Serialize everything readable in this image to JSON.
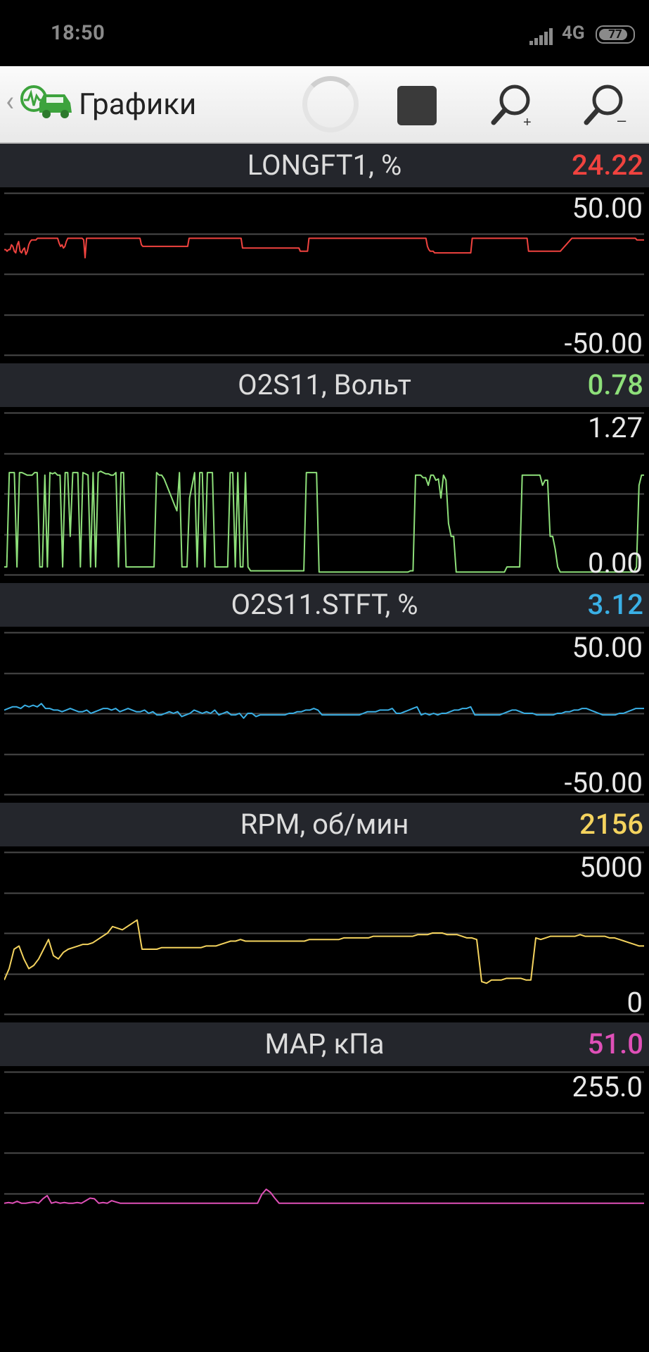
{
  "status_bar": {
    "time": "18:50",
    "network": "4G",
    "battery": "77"
  },
  "toolbar": {
    "title": "Графики",
    "icons": [
      "back-chevron-icon",
      "app-logo-icon",
      "progress-spinner-icon",
      "stop-icon",
      "zoom-in-icon",
      "zoom-out-icon"
    ]
  },
  "charts": [
    {
      "name": "LONGFT1, %",
      "value": "24.22",
      "color": "#f0433f",
      "ymax": "50.00",
      "ymin": "-50.00",
      "range": [
        -50,
        50
      ],
      "series": [
        15,
        15,
        14,
        15,
        15,
        18,
        17,
        14,
        13,
        18,
        20,
        14,
        13,
        15,
        16,
        12,
        14,
        18,
        20,
        21,
        21,
        21,
        21,
        22,
        22,
        22,
        22,
        22,
        22,
        22,
        22,
        22,
        22,
        22,
        22,
        22,
        22,
        22,
        19,
        17,
        18,
        16,
        17,
        20,
        22,
        22,
        22,
        22,
        22,
        22,
        22,
        22,
        22,
        22,
        22,
        21,
        10,
        22,
        22,
        22,
        22,
        22,
        22,
        22,
        22,
        22,
        22,
        22,
        22,
        22,
        22,
        22,
        22,
        22,
        22,
        22,
        22,
        22,
        22,
        22,
        22,
        22,
        22,
        22,
        22,
        22,
        22,
        22,
        22,
        22,
        22,
        22,
        22,
        22,
        22,
        18,
        17,
        17,
        17,
        17,
        17,
        17,
        17,
        17,
        17,
        17,
        17,
        17,
        17,
        17,
        17,
        17,
        17,
        17,
        17,
        17,
        17,
        17,
        17,
        17,
        17,
        17,
        17,
        17,
        17,
        17,
        17,
        17,
        22,
        22,
        22,
        22,
        22,
        22,
        22,
        22,
        22,
        22,
        22,
        22,
        22,
        22,
        22,
        22,
        22,
        22,
        22,
        22,
        22,
        22,
        22,
        22,
        22,
        22,
        22,
        22,
        22,
        22,
        22,
        22,
        22,
        22,
        22,
        22,
        22,
        16,
        16,
        16,
        16,
        16,
        16,
        16,
        16,
        16,
        16,
        16,
        16,
        16,
        16,
        16,
        16,
        16,
        16,
        16,
        16,
        16,
        16,
        16,
        16,
        16,
        16,
        16,
        16,
        16,
        16,
        16,
        16,
        16,
        16,
        16,
        16,
        16,
        16,
        16,
        16,
        14,
        14,
        14,
        14,
        14,
        14,
        22,
        22,
        22,
        22,
        22,
        22,
        22,
        22,
        22,
        22,
        22,
        22,
        22,
        22,
        22,
        22,
        22,
        22,
        22,
        22,
        22,
        22,
        22,
        22,
        22,
        22,
        22,
        22,
        22,
        22,
        22,
        22,
        22,
        22,
        22,
        22,
        22,
        22,
        22,
        22,
        22,
        22,
        22,
        22,
        22,
        22,
        22,
        22,
        22,
        22,
        22,
        22,
        22,
        22,
        22,
        22,
        22,
        22,
        22,
        22,
        22,
        22,
        22,
        22,
        22,
        22,
        22,
        22,
        22,
        22,
        22,
        22,
        22,
        22,
        22,
        22,
        22,
        22,
        22,
        22,
        22,
        22,
        17,
        15,
        14,
        14,
        14,
        13,
        13,
        13,
        13,
        13,
        13,
        13,
        13,
        13,
        13,
        13,
        13,
        13,
        13,
        13,
        13,
        13,
        13,
        13,
        13,
        13,
        13,
        13,
        13,
        13,
        13,
        22,
        22,
        22,
        22,
        22,
        22,
        22,
        22,
        22,
        22,
        22,
        22,
        22,
        22,
        22,
        22,
        22,
        22,
        22,
        22,
        22,
        22,
        22,
        22,
        22,
        22,
        22,
        22,
        22,
        22,
        22,
        22,
        22,
        22,
        22,
        22,
        22,
        22,
        22,
        14,
        14,
        14,
        14,
        14,
        14,
        14,
        14,
        14,
        14,
        14,
        14,
        14,
        14,
        14,
        14,
        14,
        14,
        14,
        14,
        14,
        14,
        14,
        15,
        16,
        17,
        18,
        19,
        20,
        21,
        22,
        22,
        22,
        22,
        22,
        22,
        22,
        22,
        22,
        22,
        22,
        22,
        22,
        22,
        22,
        22,
        22,
        22,
        22,
        22,
        22,
        22,
        22,
        22,
        22,
        22,
        22,
        22,
        22,
        22,
        22,
        22,
        22,
        22,
        22,
        22,
        22,
        22,
        22,
        22,
        22,
        22,
        22,
        22,
        22,
        21,
        21,
        21,
        21,
        21,
        21
      ]
    },
    {
      "name": "O2S11, Вольт",
      "value": "0.78",
      "color": "#8ee07a",
      "ymax": "1.27",
      "ymin": "0.00",
      "range": [
        0,
        1.27
      ],
      "series": [
        0.06,
        0.06,
        0.8,
        0.8,
        0.8,
        0.06,
        0.8,
        0.8,
        0.79,
        0.78,
        0.78,
        0.78,
        0.8,
        0.8,
        0.06,
        0.06,
        0.78,
        0.06,
        0.8,
        0.79,
        0.8,
        0.78,
        0.78,
        0.06,
        0.8,
        0.8,
        0.3,
        0.8,
        0.8,
        0.8,
        0.06,
        0.8,
        0.79,
        0.78,
        0.06,
        0.8,
        0.06,
        0.8,
        0.81,
        0.8,
        0.79,
        0.79,
        0.78,
        0.78,
        0.8,
        0.06,
        0.8,
        0.8,
        0.06,
        0.06,
        0.06,
        0.06,
        0.06,
        0.06,
        0.06,
        0.06,
        0.06,
        0.06,
        0.06,
        0.06,
        0.8,
        0.78,
        0.78,
        0.75,
        0.7,
        0.65,
        0.6,
        0.55,
        0.5,
        0.8,
        0.06,
        0.06,
        0.06,
        0.6,
        0.7,
        0.8,
        0.06,
        0.8,
        0.8,
        0.06,
        0.8,
        0.8,
        0.8,
        0.06,
        0.06,
        0.06,
        0.06,
        0.06,
        0.06,
        0.8,
        0.8,
        0.06,
        0.8,
        0.06,
        0.06,
        0.8,
        0.06,
        0.03,
        0.03,
        0.03,
        0.03,
        0.03,
        0.03,
        0.03,
        0.03,
        0.03,
        0.03,
        0.03,
        0.03,
        0.03,
        0.03,
        0.03,
        0.03,
        0.03,
        0.03,
        0.03,
        0.03,
        0.03,
        0.03,
        0.8,
        0.8,
        0.8,
        0.8,
        0.8,
        0.02,
        0.02,
        0.02,
        0.02,
        0.02,
        0.02,
        0.02,
        0.02,
        0.02,
        0.02,
        0.02,
        0.02,
        0.02,
        0.02,
        0.02,
        0.02,
        0.02,
        0.02,
        0.02,
        0.02,
        0.02,
        0.02,
        0.02,
        0.02,
        0.02,
        0.02,
        0.02,
        0.02,
        0.02,
        0.02,
        0.02,
        0.02,
        0.02,
        0.02,
        0.02,
        0.02,
        0.03,
        0.03,
        0.78,
        0.78,
        0.78,
        0.76,
        0.76,
        0.7,
        0.78,
        0.78,
        0.74,
        0.75,
        0.6,
        0.78,
        0.74,
        0.4,
        0.3,
        0.3,
        0.02,
        0.02,
        0.02,
        0.02,
        0.02,
        0.02,
        0.02,
        0.02,
        0.02,
        0.02,
        0.02,
        0.02,
        0.02,
        0.02,
        0.02,
        0.02,
        0.02,
        0.02,
        0.02,
        0.02,
        0.06,
        0.06,
        0.06,
        0.06,
        0.06,
        0.06,
        0.78,
        0.78,
        0.78,
        0.78,
        0.78,
        0.78,
        0.78,
        0.78,
        0.7,
        0.74,
        0.74,
        0.3,
        0.3,
        0.2,
        0.06,
        0.02,
        0.02,
        0.02,
        0.02,
        0.02,
        0.02,
        0.02,
        0.02,
        0.02,
        0.02,
        0.02,
        0.02,
        0.02,
        0.02,
        0.02,
        0.02,
        0.02,
        0.02,
        0.02,
        0.02,
        0.02,
        0.02,
        0.02,
        0.02,
        0.02,
        0.02,
        0.02,
        0.02,
        0.02,
        0.02,
        0.06,
        0.7,
        0.78,
        0.78
      ]
    },
    {
      "name": "O2S11.STFT, %",
      "value": "3.12",
      "color": "#3ab0e6",
      "ymax": "50.00",
      "ymin": "-50.00",
      "range": [
        -50,
        50
      ],
      "series": [
        2,
        3,
        4,
        4,
        3,
        5,
        4,
        5,
        4,
        6,
        3,
        3,
        2,
        2,
        1,
        2,
        3,
        2,
        1,
        1,
        2,
        0,
        1,
        2,
        3,
        3,
        2,
        3,
        1,
        2,
        3,
        2,
        1,
        1,
        2,
        0,
        1,
        -1,
        -1,
        0,
        1,
        0,
        1,
        -2,
        -1,
        0,
        2,
        1,
        0,
        1,
        0,
        2,
        -1,
        0,
        1,
        -1,
        -1,
        0,
        -3,
        0,
        0,
        -2,
        -1,
        -1,
        -1,
        -1,
        -1,
        -1,
        -1,
        0,
        0,
        1,
        1,
        2,
        2,
        3,
        2,
        -1,
        -1,
        -1,
        -1,
        -1,
        -1,
        -1,
        -1,
        -1,
        -1,
        0,
        1,
        1,
        1,
        2,
        2,
        2,
        3,
        0,
        0,
        1,
        2,
        3,
        4,
        -1,
        0,
        -1,
        0,
        -1,
        0,
        0,
        1,
        2,
        2,
        3,
        3,
        4,
        -1,
        -1,
        -1,
        -1,
        -1,
        -1,
        -1,
        0,
        1,
        2,
        2,
        1,
        0,
        0,
        0,
        -1,
        -1,
        -1,
        -1,
        -1,
        0,
        0,
        1,
        1,
        2,
        2,
        3,
        3,
        2,
        1,
        0,
        -1,
        -1,
        -1,
        -1,
        0,
        0,
        1,
        2,
        3,
        3,
        3
      ]
    },
    {
      "name": "RPM, об/мин",
      "value": "2156",
      "color": "#f4d35e",
      "ymax": "5000",
      "ymin": "0",
      "range": [
        0,
        5000
      ],
      "series": [
        1050,
        1400,
        2000,
        2100,
        1700,
        1400,
        1500,
        1700,
        2000,
        2300,
        1800,
        1700,
        1900,
        2000,
        2050,
        2100,
        2150,
        2150,
        2200,
        2300,
        2400,
        2500,
        2700,
        2650,
        2600,
        2700,
        2800,
        2900,
        2000,
        2000,
        2000,
        2000,
        2050,
        2050,
        2050,
        2050,
        2050,
        2050,
        2050,
        2050,
        2050,
        2100,
        2100,
        2100,
        2150,
        2200,
        2250,
        2250,
        2300,
        2250,
        2250,
        2250,
        2250,
        2250,
        2250,
        2250,
        2250,
        2250,
        2250,
        2250,
        2250,
        2250,
        2300,
        2300,
        2300,
        2300,
        2300,
        2300,
        2300,
        2350,
        2350,
        2350,
        2350,
        2350,
        2350,
        2400,
        2400,
        2400,
        2400,
        2400,
        2400,
        2400,
        2400,
        2400,
        2450,
        2450,
        2450,
        2500,
        2500,
        2500,
        2450,
        2450,
        2450,
        2400,
        2350,
        2350,
        2300,
        1000,
        950,
        1050,
        1050,
        1050,
        1100,
        1100,
        1100,
        1100,
        1050,
        1050,
        2350,
        2300,
        2350,
        2400,
        2400,
        2400,
        2400,
        2400,
        2400,
        2450,
        2400,
        2400,
        2400,
        2400,
        2400,
        2350,
        2350,
        2300,
        2250,
        2200,
        2150,
        2100,
        2100
      ]
    },
    {
      "name": "MAP, кПа",
      "value": "51.0",
      "color": "#e050b8",
      "ymax": "255.0",
      "ymin": "",
      "range": [
        0,
        255
      ],
      "series": [
        48,
        49,
        48,
        51,
        48,
        48,
        49,
        50,
        48,
        55,
        60,
        48,
        50,
        48,
        49,
        48,
        48,
        49,
        48,
        52,
        56,
        55,
        48,
        49,
        48,
        52,
        50,
        48,
        48,
        48,
        48,
        48,
        48,
        48,
        48,
        48,
        48,
        48,
        48,
        48,
        48,
        48,
        48,
        48,
        48,
        48,
        48,
        48,
        48,
        48,
        48,
        48,
        48,
        48,
        48,
        48,
        48,
        48,
        48,
        48,
        62,
        70,
        65,
        56,
        48,
        48,
        48,
        48,
        48,
        48,
        48,
        48,
        48,
        48,
        48,
        48,
        48,
        48,
        48,
        48,
        48,
        48,
        48,
        48,
        48,
        48,
        48,
        48,
        48,
        48,
        48,
        48,
        48,
        48,
        48,
        48,
        48,
        48,
        48,
        48,
        48,
        48,
        48,
        48,
        48,
        48,
        48,
        48,
        48,
        48,
        48,
        48,
        48,
        48,
        48,
        48,
        48,
        48,
        48,
        48,
        48,
        48,
        48,
        48,
        48,
        48,
        48,
        48,
        48,
        48,
        48,
        48,
        48,
        48,
        48,
        48,
        48,
        48,
        48,
        48,
        48,
        48,
        48,
        48,
        48,
        48,
        48,
        48,
        48,
        48
      ]
    }
  ]
}
